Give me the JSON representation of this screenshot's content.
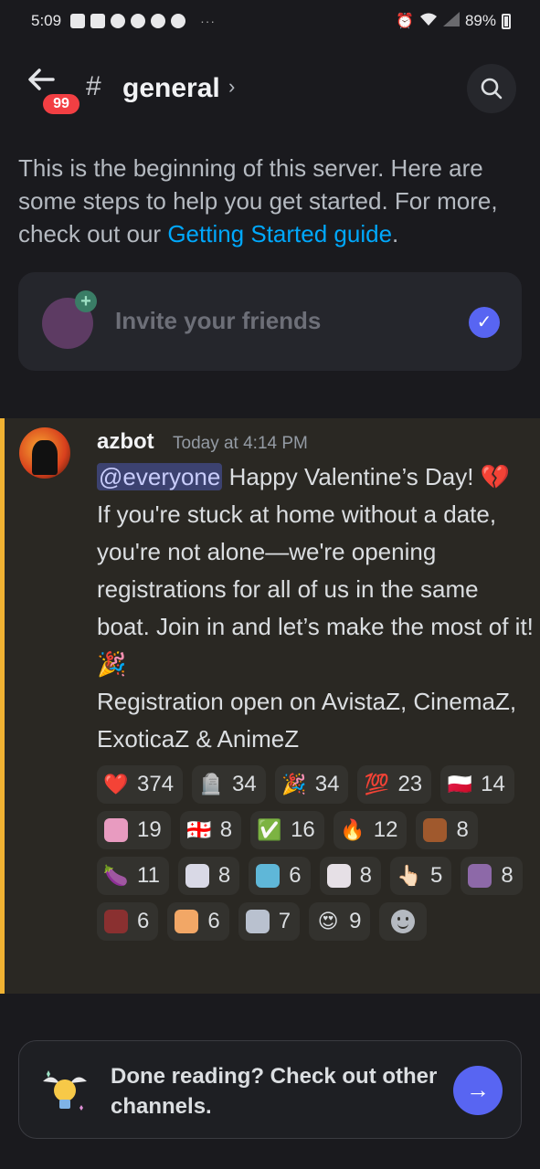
{
  "status_bar": {
    "time": "5:09",
    "dots": "···",
    "battery": "89%"
  },
  "header": {
    "back_badge": "99",
    "hash": "#",
    "channel": "general",
    "chevron": "›"
  },
  "intro": {
    "text_before": "This is the beginning of this server. Here are some steps to help you get started. For more, check out our ",
    "link": "Getting Started guide",
    "text_after": "."
  },
  "invite": {
    "label": "Invite your friends"
  },
  "message": {
    "author": "azbot",
    "timestamp": "Today at 4:14 PM",
    "mention": "@everyone",
    "line1": " Happy Valentine’s Day! 💔",
    "body": "If you're stuck at home without a date, you're not alone—we're opening registrations for all of us in the same boat. Join in and let’s make the most of it! 🎉",
    "registration": "Registration open on AvistaZ, CinemaZ, ExoticaZ & AnimeZ"
  },
  "reactions": [
    {
      "emoji": "❤️",
      "count": "374"
    },
    {
      "emoji": "🪦",
      "count": "34"
    },
    {
      "emoji": "🎉",
      "count": "34"
    },
    {
      "emoji": "💯",
      "count": "23"
    },
    {
      "emoji": "🇵🇱",
      "count": "14"
    },
    {
      "emoji": "custom-anime-pink",
      "count": "19"
    },
    {
      "emoji": "🇬🇪",
      "count": "8"
    },
    {
      "emoji": "✅",
      "count": "16"
    },
    {
      "emoji": "🔥",
      "count": "12"
    },
    {
      "emoji": "custom-anime-brown",
      "count": "8"
    },
    {
      "emoji": "🍆",
      "count": "11"
    },
    {
      "emoji": "custom-anime-white",
      "count": "8"
    },
    {
      "emoji": "custom-blue-cat",
      "count": "6"
    },
    {
      "emoji": "custom-anime-cry",
      "count": "8"
    },
    {
      "emoji": "👆🏻",
      "count": "5"
    },
    {
      "emoji": "custom-anime-purple",
      "count": "8"
    },
    {
      "emoji": "custom-anime-red",
      "count": "6"
    },
    {
      "emoji": "custom-fox",
      "count": "6"
    },
    {
      "emoji": "custom-anime-grey",
      "count": "7"
    },
    {
      "emoji": "😍",
      "count": "9"
    }
  ],
  "done_card": {
    "text": "Done reading? Check out other channels.",
    "arrow": "→"
  },
  "colors": {
    "accent": "#5865f2",
    "link": "#00a8fc",
    "highlight_bar": "#f0b232",
    "badge": "#f23f43"
  }
}
